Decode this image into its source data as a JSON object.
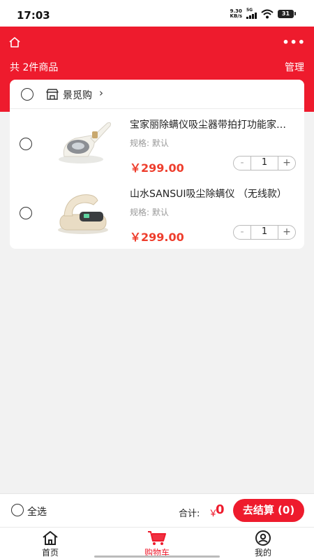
{
  "status_bar": {
    "time": "17:03",
    "net_speed_value": "9.30",
    "net_speed_unit": "KB/s",
    "signal_label": "5G",
    "battery": "31"
  },
  "header": {
    "count_text": "共 2件商品",
    "manage_label": "管理",
    "more_icon": "more-icon",
    "home_icon": "home-icon"
  },
  "store": {
    "name": "景觅购",
    "arrow": "›"
  },
  "items": [
    {
      "title": "宝家丽除螨仪吸尘器带拍打功能家用床上小型除螨机",
      "spec": "规格:  默认",
      "price": "￥299.00",
      "quantity": "1",
      "minus": "-",
      "plus": "+"
    },
    {
      "title": "山水SANSUI吸尘除螨仪 （无线款）",
      "spec": "规格:  默认",
      "price": "￥299.00",
      "quantity": "1",
      "minus": "-",
      "plus": "+"
    }
  ],
  "bottom": {
    "select_all": "全选",
    "total_label": "合计:",
    "total_currency": "￥",
    "total_value": "0",
    "checkout": "去结算 (0)"
  },
  "tabs": [
    {
      "label": "首页",
      "icon": "home-icon"
    },
    {
      "label": "购物车",
      "icon": "cart-icon"
    },
    {
      "label": "我的",
      "icon": "user-icon"
    }
  ],
  "colors": {
    "brand_red": "#ee1b2d",
    "price_red": "#ee3e2d"
  }
}
